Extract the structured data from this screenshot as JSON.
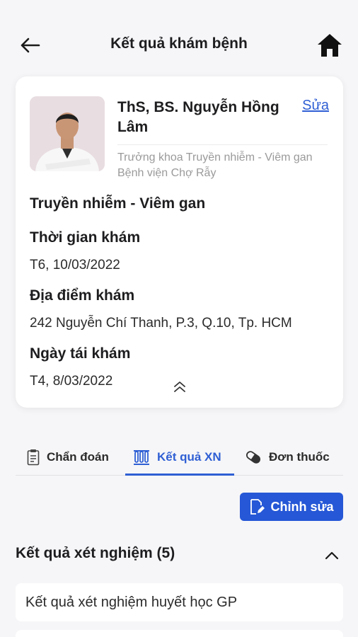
{
  "header": {
    "title": "Kết quả khám bệnh"
  },
  "doctor": {
    "name": "ThS, BS. Nguyễn Hồng Lâm",
    "edit_label": "Sửa",
    "title": "Trưởng khoa Truyền nhiễm - Viêm gan Bệnh viện Chợ Rẫy",
    "specialty": "Truyền nhiễm - Viêm gan"
  },
  "appointment": {
    "time_label": "Thời gian khám",
    "time_value": "T6, 10/03/2022",
    "location_label": "Địa điểm khám",
    "location_value": "242 Nguyễn Chí Thanh, P.3, Q.10, Tp. HCM",
    "revisit_label": "Ngày tái khám",
    "revisit_value": "T4, 8/03/2022"
  },
  "tabs": [
    {
      "label": "Chẩn đoán",
      "icon": "clipboard-icon"
    },
    {
      "label": "Kết quả XN",
      "icon": "test-tubes-icon",
      "active": true
    },
    {
      "label": "Đơn thuốc",
      "icon": "pill-icon"
    }
  ],
  "actions": {
    "edit_button": "Chỉnh sửa"
  },
  "results": {
    "title": "Kết quả xét nghiệm (5)",
    "items": [
      {
        "label": "Kết quả xét nghiệm huyết học GP"
      },
      {
        "label": ""
      }
    ]
  },
  "colors": {
    "accent": "#2557d6",
    "link": "#2f5fd4",
    "background": "#f6f6f8"
  }
}
